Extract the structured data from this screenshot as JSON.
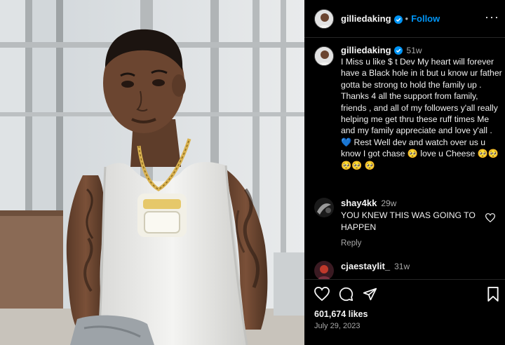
{
  "post": {
    "username": "gilliedaking",
    "follow_label": "Follow",
    "dot": "•",
    "more_label": "···",
    "caption_time": "51w",
    "caption_text": "I Miss u like $   t Dev My heart will forever have a Black hole in it but u know ur father gotta be strong to hold the family up . Thanks 4 all the support from family, friends , and all of my followers y'all really helping me get thru these ruff times Me and my family appreciate and love y'all . 💙 Rest Well dev and watch over us u know I got chase 🥺 love u Cheese 🥺🥺🥺🥺 🥺",
    "comments": [
      {
        "username": "shay4kk",
        "time": "29w",
        "text": "YOU KNEW THIS WAS GOING TO HAPPEN",
        "reply_label": "Reply"
      },
      {
        "username": "cjaestaylit_",
        "time": "31w"
      }
    ],
    "likes": "601,674 likes",
    "date": "July 29, 2023"
  },
  "icons": {
    "heart": "heart-icon",
    "comment": "comment-icon",
    "share": "share-icon",
    "save": "bookmark-icon",
    "verified": "verified-badge-icon"
  },
  "colors": {
    "accent": "#0095f6",
    "background": "#000000",
    "muted": "#a8a8a8"
  }
}
